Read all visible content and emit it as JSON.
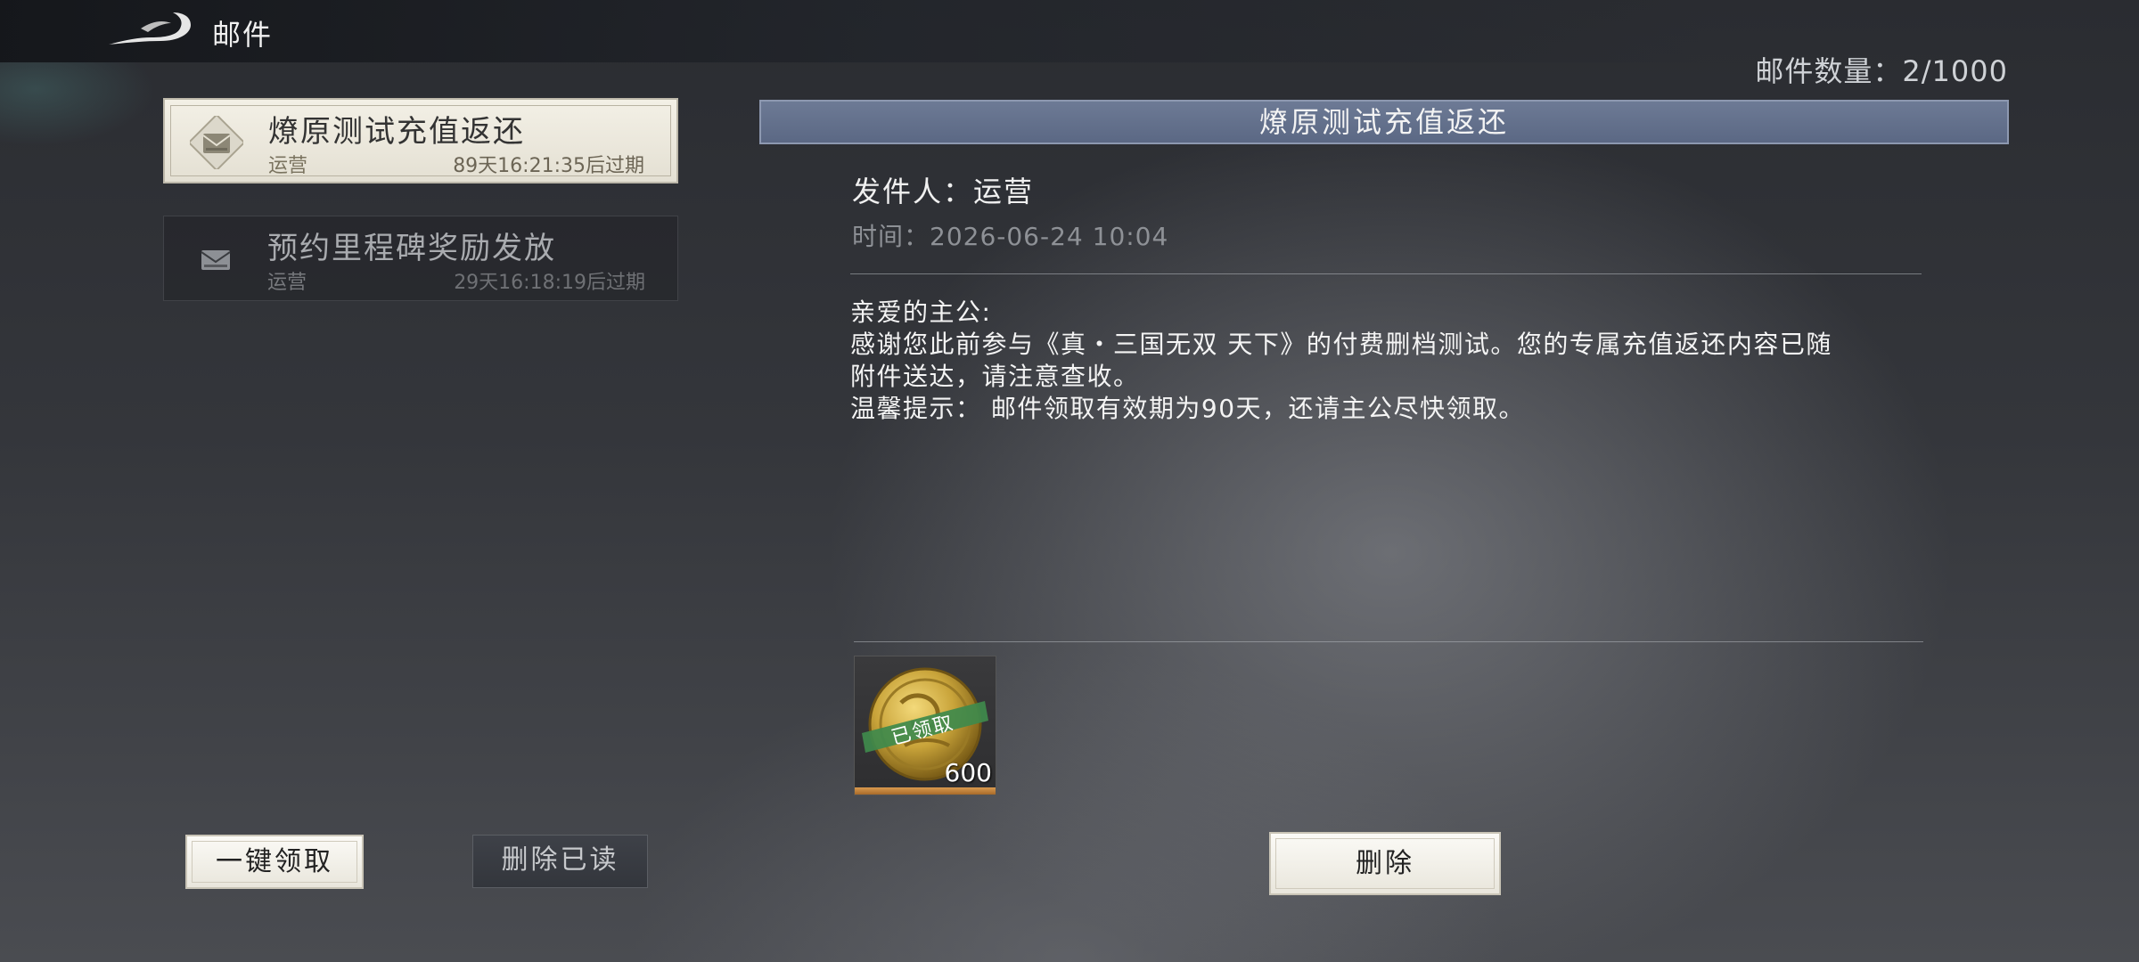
{
  "header": {
    "title": "邮件",
    "mail_count": "邮件数量：2/1000"
  },
  "mail_list": [
    {
      "subject": "燎原测试充值返还",
      "sender": "运营",
      "expiry": "89天16:21:35后过期",
      "selected": true
    },
    {
      "subject": "预约里程碑奖励发放",
      "sender": "运营",
      "expiry": "29天16:18:19后过期",
      "selected": false
    }
  ],
  "detail": {
    "title": "燎原测试充值返还",
    "sender_line": "发件人：运营",
    "time_line": "时间：2026-06-24 10:04",
    "body": [
      "亲爱的主公:",
      "感谢您此前参与《真・三国无双 天下》的付费删档测试。您的专属充值返还内容已随",
      "附件送达，请注意查收。",
      "温馨提示： 邮件领取有效期为90天，还请主公尽快领取。"
    ],
    "attachments": [
      {
        "icon": "gold-coin-icon",
        "quantity": "600",
        "status_label": "已领取"
      }
    ]
  },
  "buttons": {
    "claim_all": "一键领取",
    "delete_read": "删除已读",
    "delete": "删除"
  },
  "colors": {
    "header_bar": "#5f6c88",
    "selected_item": "#efece2",
    "claimed_ribbon": "#3f8a4c",
    "coin_gold": "#c9a43a"
  }
}
